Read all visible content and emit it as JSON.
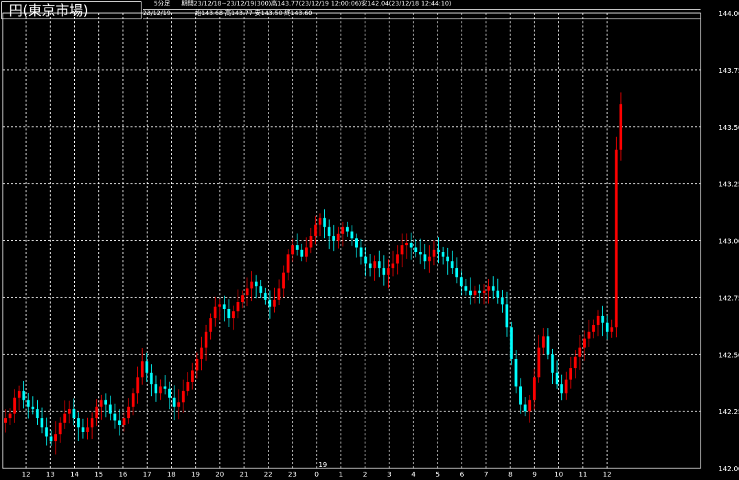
{
  "window": {
    "title": "円(東京市場)"
  },
  "header": {
    "interval": "5分足",
    "period_text": "期間23/12/18~23/12/19(300)高143.77(23/12/19 12:00:06)安142.04(23/12/18 12:44:10)",
    "date": "23/12/19",
    "ohlc_text": "始143.68 高143.77 安143.50 終143.60"
  },
  "colors": {
    "background": "#000000",
    "up": "#ff0000",
    "down": "#00ffff",
    "flat": "#00cc00",
    "grid": "#ffffff",
    "text": "#ffffff"
  },
  "chart_data": {
    "type": "candlestick",
    "grid": true,
    "ylim": [
      142.0,
      144.0
    ],
    "yticks": [
      "144.00",
      "143.75",
      "143.50",
      "143.25",
      "143.00",
      "142.75",
      "142.50",
      "142.25",
      "142.00"
    ],
    "date_marker": "19",
    "xticks": [
      "12",
      "13",
      "14",
      "15",
      "16",
      "17",
      "18",
      "19",
      "20",
      "21",
      "22",
      "23",
      "0",
      "1",
      "2",
      "3",
      "4",
      "5",
      "6",
      "7",
      "8",
      "9",
      "10",
      "11",
      "12"
    ],
    "close_series": [
      142.22,
      142.24,
      142.31,
      142.34,
      142.3,
      142.27,
      142.26,
      142.22,
      142.18,
      142.14,
      142.12,
      142.15,
      142.2,
      142.24,
      142.26,
      142.22,
      142.18,
      142.16,
      142.18,
      142.22,
      142.27,
      142.3,
      142.28,
      142.24,
      142.21,
      142.19,
      142.22,
      142.27,
      142.33,
      142.4,
      142.47,
      142.42,
      142.37,
      142.33,
      142.36,
      142.35,
      142.31,
      142.27,
      142.29,
      142.34,
      142.38,
      142.43,
      142.48,
      142.53,
      142.6,
      142.66,
      142.71,
      142.72,
      142.7,
      142.66,
      142.69,
      142.73,
      142.76,
      142.79,
      142.82,
      142.8,
      142.77,
      142.74,
      142.71,
      142.74,
      142.79,
      142.86,
      142.94,
      142.98,
      142.96,
      142.93,
      142.97,
      143.02,
      143.07,
      143.1,
      143.06,
      143.02,
      143.0,
      143.03,
      143.06,
      143.04,
      143.01,
      142.97,
      142.93,
      142.9,
      142.88,
      142.91,
      142.88,
      142.85,
      142.88,
      142.9,
      142.94,
      142.98,
      142.99,
      142.97,
      142.95,
      142.94,
      142.91,
      142.93,
      142.96,
      142.95,
      142.93,
      142.91,
      142.88,
      142.84,
      142.8,
      142.78,
      142.76,
      142.78,
      142.77,
      142.78,
      142.8,
      142.78,
      142.75,
      142.72,
      142.62,
      142.48,
      142.36,
      142.28,
      142.25,
      142.3,
      142.4,
      142.53,
      142.58,
      142.5,
      142.42,
      142.37,
      142.33,
      142.39,
      142.44,
      142.49,
      142.53,
      142.57,
      142.6,
      142.63,
      142.67,
      142.64,
      142.6,
      142.62,
      143.4,
      143.6
    ],
    "open": 143.68,
    "high": 143.77,
    "low": 142.04,
    "close": 143.6
  }
}
